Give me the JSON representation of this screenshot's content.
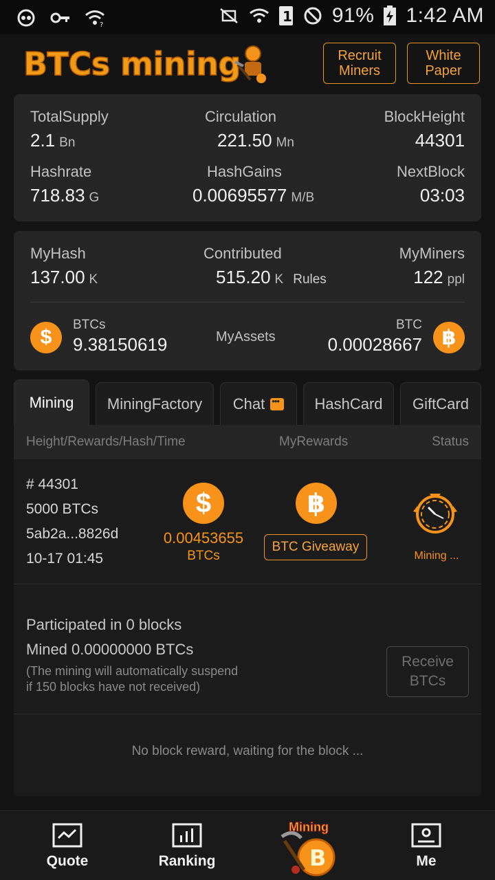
{
  "status_bar": {
    "battery": "91%",
    "time": "1:42 AM",
    "sim_label": "1",
    "icons": [
      "link-icon",
      "key-icon",
      "wifi-question-icon",
      "mute-icon",
      "wifi-icon",
      "sim-icon",
      "block-icon",
      "battery-charging-icon"
    ]
  },
  "header": {
    "logo": "BTCs mining",
    "recruit_label": "Recruit\nMiners",
    "paper_label": "White\nPaper"
  },
  "network": {
    "total_supply_label": "TotalSupply",
    "total_supply_value": "2.1",
    "total_supply_unit": "Bn",
    "circulation_label": "Circulation",
    "circulation_value": "221.50",
    "circulation_unit": "Mn",
    "block_height_label": "BlockHeight",
    "block_height_value": "44301",
    "hashrate_label": "Hashrate",
    "hashrate_value": "718.83",
    "hashrate_unit": "G",
    "hash_gains_label": "HashGains",
    "hash_gains_value": "0.00695577",
    "hash_gains_unit": "M/B",
    "next_block_label": "NextBlock",
    "next_block_value": "03:03"
  },
  "account": {
    "my_hash_label": "MyHash",
    "my_hash_value": "137.00",
    "my_hash_unit": "K",
    "contributed_label": "Contributed",
    "contributed_value": "515.20",
    "contributed_unit": "K",
    "rules_label": "Rules",
    "my_miners_label": "MyMiners",
    "my_miners_value": "122",
    "my_miners_unit": "ppl",
    "btcs_label": "BTCs",
    "btcs_value": "9.38150619",
    "my_assets_label": "MyAssets",
    "btc_label": "BTC",
    "btc_value": "0.00028667"
  },
  "tabs": [
    "Mining",
    "MiningFactory",
    "Chat",
    "HashCard",
    "GiftCard"
  ],
  "table": {
    "col_height": "Height/Rewards/Hash/Time",
    "col_rewards": "MyRewards",
    "col_status": "Status"
  },
  "block": {
    "height": "# 44301",
    "rewards": "5000 BTCs",
    "hash": "5ab2a...8826d",
    "time": "10-17 01:45",
    "my_reward_value": "0.00453655",
    "my_reward_unit": "BTCs",
    "giveaway_label": "BTC Giveaway",
    "status": "Mining ..."
  },
  "summary": {
    "participated": "Participated in 0 blocks",
    "mined": "Mined 0.00000000 BTCs",
    "note": "(The mining will automatically suspend\nif 150 blocks have not received)",
    "receive_label": "Receive\nBTCs"
  },
  "empty_message": "No block reward, waiting for the block ...",
  "nav": {
    "quote": "Quote",
    "ranking": "Ranking",
    "mining": "Mining",
    "me": "Me"
  },
  "colors": {
    "accent": "#f7931a",
    "background": "#141414",
    "card": "#262626"
  }
}
